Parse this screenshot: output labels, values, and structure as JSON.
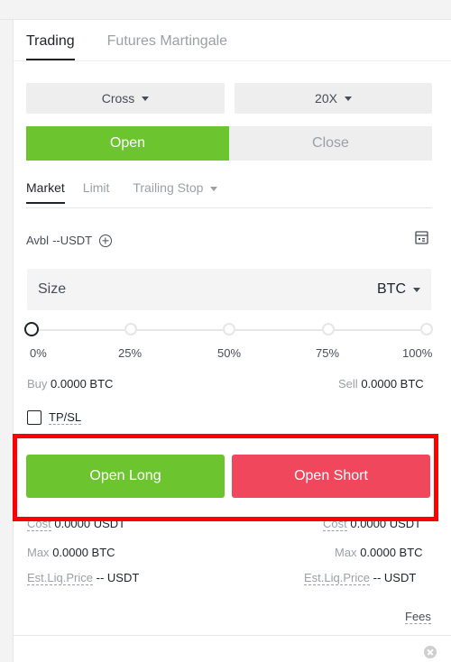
{
  "tabs": [
    {
      "label": "Trading",
      "active": true
    },
    {
      "label": "Futures Martingale",
      "active": false
    }
  ],
  "margin_mode": "Cross",
  "leverage": "20X",
  "position_tabs": {
    "open": "Open",
    "close": "Close",
    "active": "Open"
  },
  "order_tabs": [
    {
      "label": "Market",
      "active": true
    },
    {
      "label": "Limit",
      "active": false
    },
    {
      "label": "Trailing Stop",
      "active": false
    }
  ],
  "avbl": {
    "label": "Avbl",
    "value": "--USDT"
  },
  "size": {
    "placeholder": "Size",
    "unit": "BTC"
  },
  "slider": {
    "marks": [
      "0%",
      "25%",
      "50%",
      "75%",
      "100%"
    ],
    "value_percent": 0
  },
  "buy": {
    "label": "Buy",
    "value": "0.0000 BTC"
  },
  "sell": {
    "label": "Sell",
    "value": "0.0000 BTC"
  },
  "tpsl": {
    "label": "TP/SL",
    "checked": false
  },
  "buttons": {
    "long": "Open Long",
    "short": "Open Short"
  },
  "cost": {
    "label": "Cost",
    "left": "0.0000 USDT",
    "right": "0.0000 USDT"
  },
  "max": {
    "label": "Max",
    "left": "0.0000 BTC",
    "right": "0.0000 BTC"
  },
  "liq": {
    "label": "Est.Liq.Price",
    "left": "-- USDT",
    "right": "-- USDT"
  },
  "fees": "Fees",
  "colors": {
    "long": "#6cc42f",
    "short": "#f0475c",
    "highlight": "#ff0000"
  }
}
